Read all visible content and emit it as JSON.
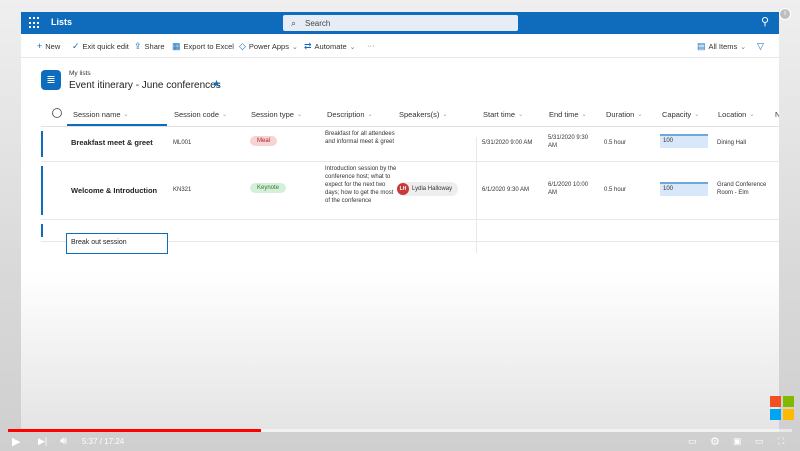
{
  "suite": {
    "app_title": "Lists",
    "search_placeholder": "Search"
  },
  "commands": [
    {
      "label": "New",
      "glyph": "+"
    },
    {
      "label": "Exit quick edit",
      "glyph": "✓"
    },
    {
      "label": "Share",
      "glyph": "⇪"
    },
    {
      "label": "Export to Excel",
      "glyph": "▦"
    },
    {
      "label": "Power Apps",
      "glyph": "◇"
    },
    {
      "label": "Automate",
      "glyph": "⇄"
    }
  ],
  "view": {
    "label": "All Items"
  },
  "header": {
    "breadcrumb": "My lists",
    "title": "Event itinerary - June conferences"
  },
  "columns": [
    "Session name",
    "Session code",
    "Session type",
    "Description",
    "Speakers(s)",
    "Start time",
    "End time",
    "Duration",
    "Capacity",
    "Location",
    "N"
  ],
  "rows": [
    {
      "name": "Breakfast meet & greet",
      "code": "ML001",
      "type": "Meal",
      "description": "Breakfast for all attendees and informal meet & greet",
      "speaker": "",
      "start": "5/31/2020 9:00 AM",
      "end": "5/31/2020 9:30 AM",
      "duration": "0.5 hour",
      "capacity": "100",
      "location": "Dining Hall"
    },
    {
      "name": "Welcome & Introduction",
      "code": "KN321",
      "type": "Keynote",
      "description": "Introduction session by the conference host; what to expect for the next two days; how to get the most of the conference",
      "speaker": "Lydia Halloway",
      "speaker_initials": "LH",
      "start": "6/1/2020 9:30 AM",
      "end": "6/1/2020 10:00 AM",
      "duration": "0.5 hour",
      "capacity": "100",
      "location": "Grand Conference Room - Elm"
    }
  ],
  "edit_row": {
    "value": "Break out session"
  },
  "player": {
    "time": "5:37 / 17:24",
    "progress": 0.323
  },
  "colors": {
    "accent": "#0f6cbd",
    "meal_pill": "#f8d3d3",
    "keynote_pill": "#d5efd9",
    "progress": "#ff0000"
  }
}
